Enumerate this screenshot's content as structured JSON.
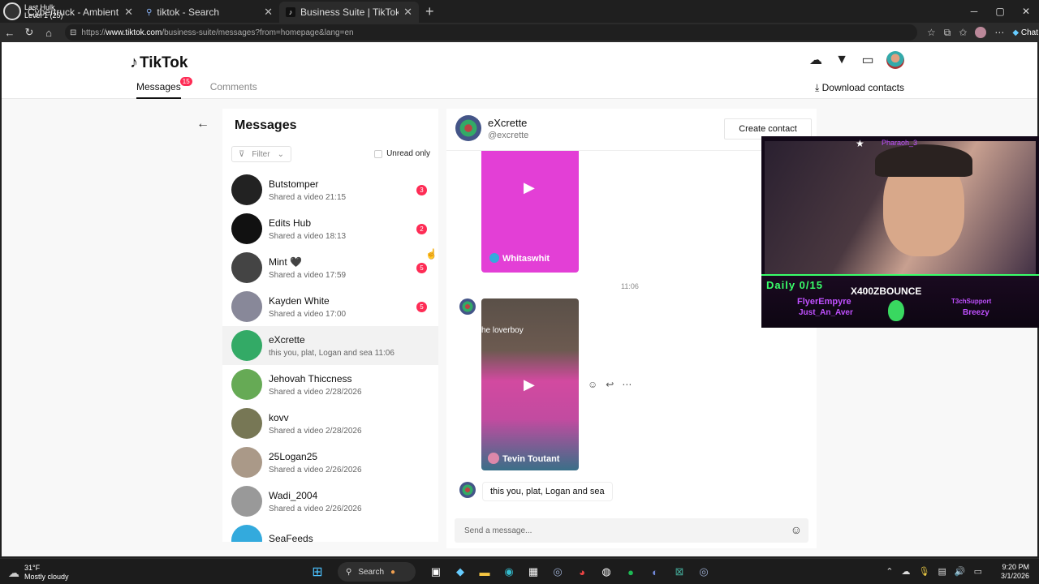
{
  "browser": {
    "overlay_tab": {
      "line1": "Last Hulk",
      "line2": "Level 1  (25)"
    },
    "tabs": [
      {
        "title": "Cybertruck - Ambient City D",
        "active": false
      },
      {
        "title": "tiktok - Search",
        "active": false
      },
      {
        "title": "Business Suite | TikTok",
        "active": true
      }
    ],
    "url_prefix": "https://",
    "url_host": "www.tiktok.com",
    "url_path": "/business-suite/messages?from=homepage&lang=en",
    "chat_label": "Chat",
    "window_controls": [
      "─",
      "▢",
      "✕"
    ]
  },
  "header": {
    "brand": "TikTok",
    "tabs": {
      "messages": "Messages",
      "messages_badge": "15",
      "comments": "Comments"
    },
    "download": "Download contacts"
  },
  "messages_panel": {
    "title": "Messages",
    "filter": "Filter",
    "unread_only": "Unread only",
    "conversations": [
      {
        "name": "Butstomper",
        "sub": "Shared a video 21:15",
        "count": "3",
        "avatar_color": "#222"
      },
      {
        "name": "Edits Hub",
        "sub": "Shared a video 18:13",
        "count": "2",
        "avatar_color": "#111"
      },
      {
        "name": "Mint 🖤",
        "sub": "Shared a video 17:59",
        "count": "5",
        "avatar_color": "#444"
      },
      {
        "name": "Kayden White",
        "sub": "Shared a video 17:00",
        "count": "5",
        "avatar_color": "#889"
      },
      {
        "name": "eXcrette",
        "sub": "this you, plat, Logan and sea 11:06",
        "count": "",
        "avatar_color": "#3a6"
      },
      {
        "name": "Jehovah Thiccness",
        "sub": "Shared a video 2/28/2026",
        "count": "",
        "avatar_color": "#6a5"
      },
      {
        "name": "kovv",
        "sub": "Shared a video 2/28/2026",
        "count": "",
        "avatar_color": "#775"
      },
      {
        "name": "25Logan25",
        "sub": "Shared a video 2/26/2026",
        "count": "",
        "avatar_color": "#a98"
      },
      {
        "name": "Wadi_2004",
        "sub": "Shared a video 2/26/2026",
        "count": "",
        "avatar_color": "#999"
      },
      {
        "name": "SeaFeeds",
        "sub": "",
        "count": "",
        "avatar_color": "#3ad"
      }
    ]
  },
  "chat": {
    "name": "eXcrette",
    "handle": "@excrette",
    "create_contact": "Create contact",
    "video1_tag": "Whitaswhit",
    "time": "11:06",
    "video2_caption": "he loverboy",
    "video2_tag": "Tevin Toutant",
    "message": "this you, plat, Logan and sea",
    "composer_placeholder": "Send a message..."
  },
  "stream_overlay": {
    "top_name": "Pharaoh_3",
    "daily": "Daily 0/15",
    "channel": "X400ZBOUNCE",
    "sub1": "FlyerEmpyre",
    "sub2": "Just_An_Aver",
    "sub3": "T3chSupport",
    "sub4": "Breezy"
  },
  "taskbar": {
    "temp": "31°F",
    "weather": "Mostly cloudy",
    "search": "Search",
    "time": "9:20 PM",
    "date": "3/1/2026"
  },
  "colors": {
    "accent": "#fe2c55"
  }
}
